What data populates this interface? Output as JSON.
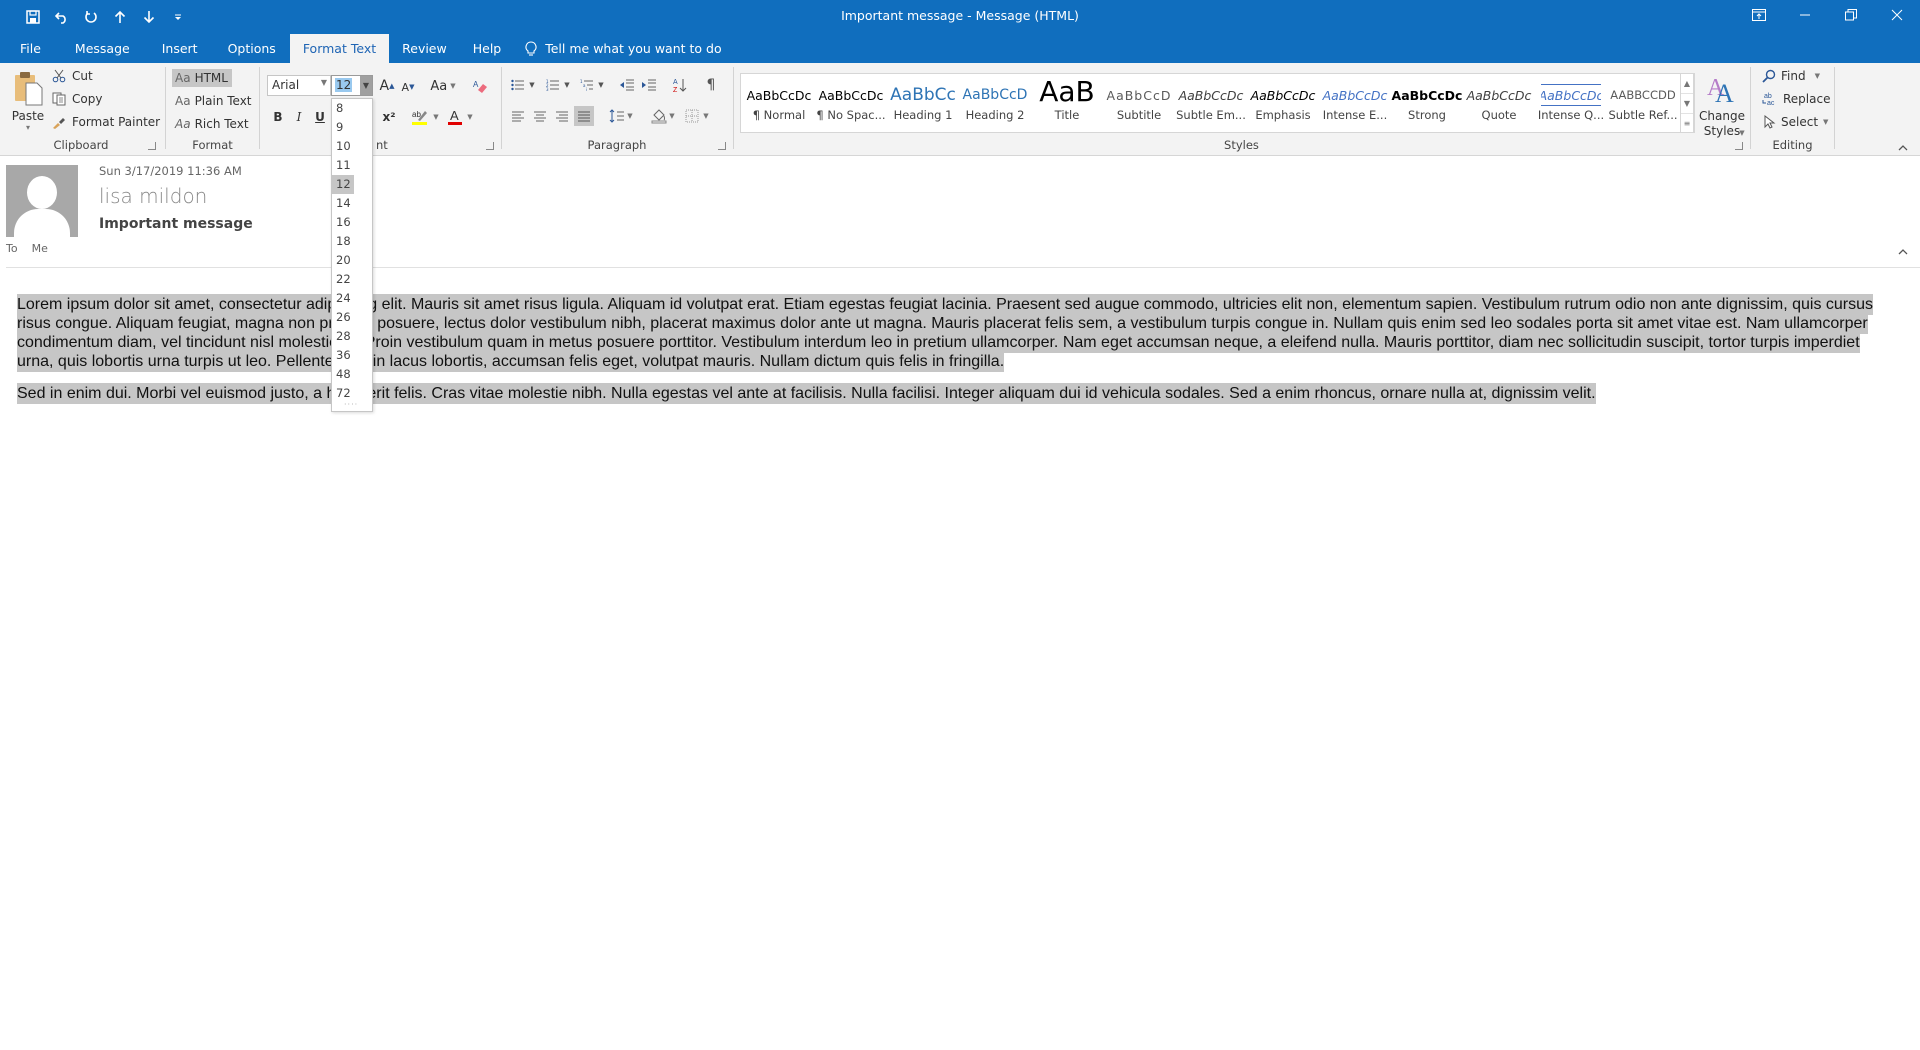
{
  "window": {
    "title": "Important message  -  Message (HTML)",
    "controls": [
      "ribbon-display-options",
      "minimize",
      "restore",
      "close"
    ]
  },
  "qat": {
    "items": [
      "save",
      "undo",
      "redo",
      "previous-item",
      "next-item",
      "customize"
    ]
  },
  "tabs": [
    {
      "label": "File"
    },
    {
      "label": "Message"
    },
    {
      "label": "Insert"
    },
    {
      "label": "Options"
    },
    {
      "label": "Format Text",
      "active": true
    },
    {
      "label": "Review"
    },
    {
      "label": "Help"
    }
  ],
  "tell_me": "Tell me what you want to do",
  "ribbon": {
    "clipboard": {
      "label": "Clipboard",
      "paste": "Paste",
      "cut": "Cut",
      "copy": "Copy",
      "format_painter": "Format Painter"
    },
    "format": {
      "label": "Format",
      "html": "HTML",
      "plain": "Plain Text",
      "rich": "Rich Text",
      "aa": "Aa",
      "selected": "HTML"
    },
    "font": {
      "label_partial": "nt",
      "font_name": "Arial",
      "font_size": "12",
      "grow": "A",
      "shrink": "A",
      "change_case": "Aa",
      "bold": "B",
      "italic": "I",
      "underline": "U",
      "superscript": "x²",
      "highlight_color": "#ffff00",
      "font_color": "#e00000"
    },
    "paragraph": {
      "label": "Paragraph",
      "alignment_selected": "justify"
    },
    "styles": {
      "label": "Styles",
      "items": [
        {
          "sample": "AaBbCcDc",
          "name": "¶ Normal"
        },
        {
          "sample": "AaBbCcDc",
          "name": "¶ No Spac..."
        },
        {
          "sample": "AaBbCc",
          "name": "Heading 1"
        },
        {
          "sample": "AaBbCcD",
          "name": "Heading 2"
        },
        {
          "sample": "AaB",
          "name": "Title"
        },
        {
          "sample": "AaBbCcD",
          "name": "Subtitle"
        },
        {
          "sample": "AaBbCcDc",
          "name": "Subtle Em..."
        },
        {
          "sample": "AaBbCcDc",
          "name": "Emphasis"
        },
        {
          "sample": "AaBbCcDc",
          "name": "Intense E..."
        },
        {
          "sample": "AaBbCcDc",
          "name": "Strong"
        },
        {
          "sample": "AaBbCcDc",
          "name": "Quote"
        },
        {
          "sample": "AaBbCcDc",
          "name": "Intense Q..."
        },
        {
          "sample": "AABBCCDD",
          "name": "Subtle Ref..."
        }
      ],
      "change_styles": "Change Styles"
    },
    "editing": {
      "label": "Editing",
      "find": "Find",
      "replace": "Replace",
      "select": "Select"
    }
  },
  "message": {
    "date": "Sun 3/17/2019 11:36 AM",
    "from": "lisa mildon",
    "subject": "Important message",
    "to_label": "To",
    "to_value": "Me"
  },
  "body": {
    "paragraphs": [
      "Lorem ipsum dolor sit amet, consectetur adipiscing elit. Mauris sit amet risus ligula. Aliquam id volutpat erat. Etiam egestas feugiat lacinia. Praesent sed augue commodo, ultricies elit non, elementum sapien. Vestibulum rutrum odio non ante dignissim, quis cursus risus congue. Aliquam feugiat, magna non pretium posuere, lectus dolor vestibulum nibh, placerat maximus dolor ante ut magna. Mauris placerat felis sem, a vestibulum turpis congue in. Nullam quis enim sed leo sodales porta sit amet vitae est. Nam ullamcorper condimentum diam, vel tincidunt nisl molestie at. Proin vestibulum quam in metus posuere porttitor. Vestibulum interdum leo in pretium ullamcorper. Nam eget accumsan neque, a eleifend nulla. Mauris porttitor, diam nec sollicitudin suscipit, tortor turpis imperdiet urna, quis lobortis urna turpis ut leo. Pellentesque in lacus lobortis, accumsan felis eget, volutpat mauris. Nullam dictum quis felis in fringilla.",
      "Sed in enim dui. Morbi vel euismod justo, a hendrerit felis. Cras vitae molestie nibh. Nulla egestas vel ante at facilisis. Nulla facilisi. Integer aliquam dui id vehicula sodales. Sed a enim rhoncus, ornare nulla at, dignissim velit."
    ]
  },
  "size_dropdown": {
    "options": [
      "8",
      "9",
      "10",
      "11",
      "12",
      "14",
      "16",
      "18",
      "20",
      "22",
      "24",
      "26",
      "28",
      "36",
      "48",
      "72"
    ],
    "selected": "12"
  },
  "colors": {
    "accent": "#106ebe",
    "selection_highlight": "#c6c6c6",
    "ribbon_bg": "#f3f3f3"
  }
}
